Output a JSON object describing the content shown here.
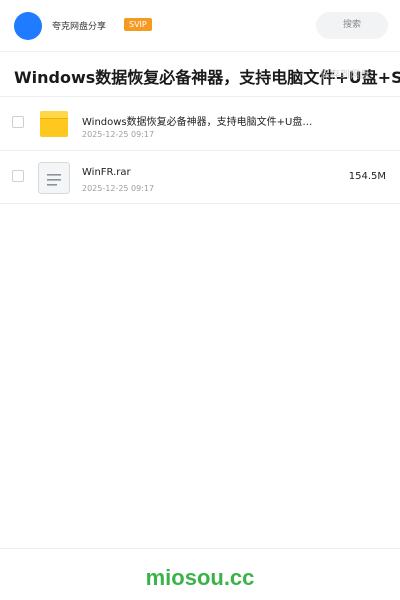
{
  "header": {
    "user_name": "夸克网盘分享",
    "badge": "SVIP",
    "search_placeholder": "搜索",
    "avatar_color": "#1f7bff"
  },
  "share": {
    "title": "Windows数据恢复必备神器，支持电脑文件+U盘+SD卡一",
    "save_label": "保存到网盘"
  },
  "files": [
    {
      "name": "Windows数据恢复必备神器，支持电脑文件+U盘…",
      "date": "2025-12-25 09:17",
      "size": "",
      "icon": "folder-icon"
    },
    {
      "name": "WinFR.rar",
      "date": "2025-12-25 09:17",
      "size": "154.5M",
      "icon": "archive-file-icon"
    }
  ],
  "footer": {
    "brand": "miosou.cc",
    "brand_color": "#3cb34a"
  }
}
